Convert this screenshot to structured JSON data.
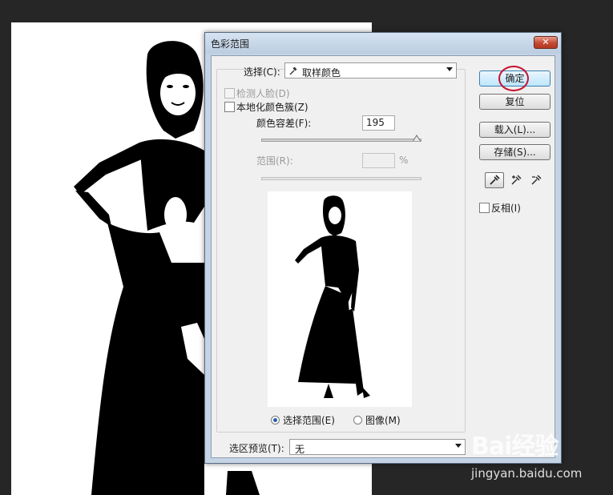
{
  "dialog": {
    "title": "色彩范围",
    "close_label": "✕"
  },
  "select": {
    "label": "选择(C):",
    "value": "取样颜色"
  },
  "options": {
    "detect_faces": "检测人脸(D)",
    "localized_clusters": "本地化颜色簇(Z)"
  },
  "fuzziness": {
    "label": "颜色容差(F):",
    "value": "195",
    "fraction": 0.97
  },
  "range": {
    "label": "范围(R):",
    "unit": "%"
  },
  "preview_mode": {
    "selection": "选择范围(E)",
    "image": "图像(M)"
  },
  "selection_preview": {
    "label": "选区预览(T):",
    "value": "无"
  },
  "buttons": {
    "ok": "确定",
    "reset": "复位",
    "load": "载入(L)...",
    "save": "存储(S)..."
  },
  "invert": {
    "label": "反相(I)"
  },
  "tools": [
    "eyedropper-icon",
    "eyedropper-plus-icon",
    "eyedropper-minus-icon"
  ],
  "watermark": {
    "brand": "Bai经验",
    "url": "jingyan.baidu.com"
  },
  "colors": {
    "ok_ring": "#c8102e",
    "close_button": "#c44a32",
    "primary_button": "#bee6fd"
  }
}
